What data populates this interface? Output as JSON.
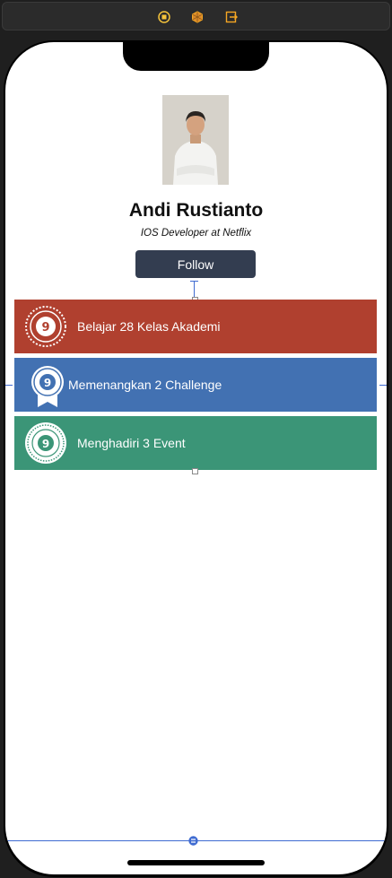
{
  "toolbar": {
    "icons": [
      "first-responder-icon",
      "object-cube-icon",
      "exit-icon"
    ],
    "accent": "#f5a623"
  },
  "profile": {
    "name": "Andi Rustianto",
    "role": "IOS Developer at Netflix",
    "follow_label": "Follow"
  },
  "achievements": [
    {
      "label": "Belajar 28 Kelas Akademi",
      "icon": "academy-badge-icon",
      "color": "#b0402f"
    },
    {
      "label": "Memenangkan 2 Challenge",
      "icon": "challenge-ribbon-icon",
      "color": "#4271b2"
    },
    {
      "label": "Menghadiri 3 Event",
      "icon": "event-seal-icon",
      "color": "#3b9577"
    }
  ],
  "colors": {
    "button": "#333d50",
    "guide": "#3f6bd1"
  }
}
